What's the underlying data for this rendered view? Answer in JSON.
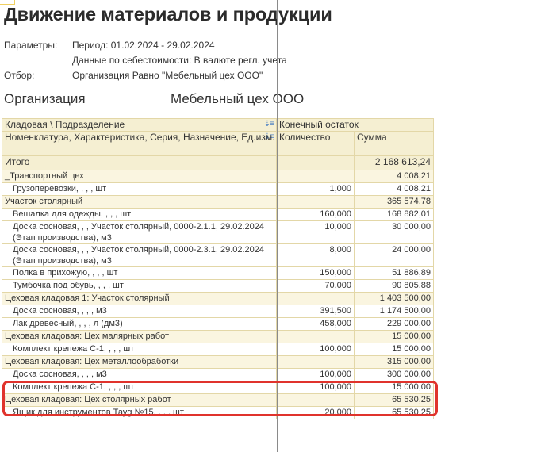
{
  "report": {
    "title": "Движение материалов и продукции"
  },
  "params": [
    {
      "label": "Параметры:",
      "value": "Период: 01.02.2024 - 29.02.2024"
    },
    {
      "label": "",
      "value": "Данные по себестоимости: В валюте регл. учета"
    },
    {
      "label": "Отбор:",
      "value": "Организация Равно \"Мебельный цех ООО\""
    }
  ],
  "organization": {
    "label": "Организация",
    "value": "Мебельный цех ООО"
  },
  "table": {
    "header1": {
      "left": "Кладовая \\ Подразделение",
      "right": "Конечный остаток"
    },
    "header2": {
      "left": "Номенклатура, Характеристика, Серия, Назначение, Ед.изм.",
      "qty": "Количество",
      "sum": "Сумма"
    },
    "sort_icon": "⇣≡",
    "total": {
      "label": "Итого",
      "sum": "2 168 613,24"
    },
    "rows": [
      {
        "type": "group",
        "name": "_Транспортный цех",
        "qty": "",
        "sum": "4 008,21"
      },
      {
        "type": "item",
        "name": "Грузоперевозки, , , , шт",
        "qty": "1,000",
        "sum": "4 008,21"
      },
      {
        "type": "group",
        "name": "Участок столярный",
        "qty": "",
        "sum": "365 574,78"
      },
      {
        "type": "item",
        "name": "Вешалка для одежды, , , , шт",
        "qty": "160,000",
        "sum": "168 882,01"
      },
      {
        "type": "item wrap",
        "name": "Доска сосновая, , , Участок столярный, 0000-2.1.1, 29.02.2024 (Этап производства), м3",
        "qty": "10,000",
        "sum": "30 000,00"
      },
      {
        "type": "item wrap",
        "name": "Доска сосновая, , , Участок столярный, 0000-2.3.1, 29.02.2024 (Этап производства), м3",
        "qty": "8,000",
        "sum": "24 000,00"
      },
      {
        "type": "item",
        "name": "Полка в прихожую, , , , шт",
        "qty": "150,000",
        "sum": "51 886,89"
      },
      {
        "type": "item",
        "name": "Тумбочка под обувь, , , , шт",
        "qty": "70,000",
        "sum": "90 805,88"
      },
      {
        "type": "group",
        "name": "Цеховая кладовая 1: Участок столярный",
        "qty": "",
        "sum": "1 403 500,00"
      },
      {
        "type": "item",
        "name": "Доска сосновая, , , , м3",
        "qty": "391,500",
        "sum": "1 174 500,00"
      },
      {
        "type": "item",
        "name": "Лак древесный, , , , л (дм3)",
        "qty": "458,000",
        "sum": "229 000,00"
      },
      {
        "type": "group",
        "name": "Цеховая кладовая: Цех малярных работ",
        "qty": "",
        "sum": "15 000,00"
      },
      {
        "type": "item",
        "name": "Комплект крепежа С-1, , , , шт",
        "qty": "100,000",
        "sum": "15 000,00"
      },
      {
        "type": "group",
        "name": "Цеховая кладовая: Цех металлообработки",
        "qty": "",
        "sum": "315 000,00"
      },
      {
        "type": "item",
        "name": "Доска сосновая, , , , м3",
        "qty": "100,000",
        "sum": "300 000,00"
      },
      {
        "type": "item",
        "name": "Комплект крепежа С-1, , , , шт",
        "qty": "100,000",
        "sum": "15 000,00"
      },
      {
        "type": "group",
        "name": "Цеховая кладовая: Цех столярных работ",
        "qty": "",
        "sum": "65 530,25"
      },
      {
        "type": "item",
        "name": "Ящик для инструментов Тауg №15, , , , шт",
        "qty": "20,000",
        "sum": "65 530,25"
      }
    ]
  },
  "colors": {
    "header_bg": "#f5efd2",
    "highlight": "#e0332c",
    "border": "#e3d7a7"
  }
}
